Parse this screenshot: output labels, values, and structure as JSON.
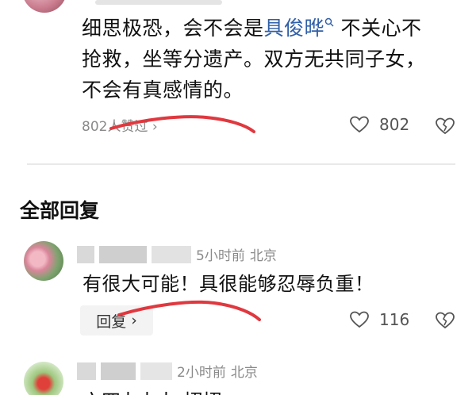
{
  "top_comment": {
    "lines": [
      "细思极恐，会不会是",
      "抢救，坐等分遗产。双方无共同子女，",
      "不会有真感情的。"
    ],
    "link_text": "具俊晔",
    "line1_tail": "不关心不",
    "likes_summary": "802人赞过",
    "like_count": "802"
  },
  "section": {
    "title": "全部回复"
  },
  "reply1": {
    "time": "5小时前",
    "location": "北京",
    "text": "有很大可能！具很能够忍辱负重！",
    "reply_label": "回复",
    "like_count": "116"
  },
  "reply2": {
    "time": "2小时前",
    "location": "北京",
    "text_partial": "六四九九九 招招"
  },
  "colors": {
    "link": "#2f5fa8",
    "annotation": "#e0383f",
    "muted": "#8a8a8a"
  },
  "icons": [
    "heart-icon",
    "broken-heart-icon",
    "search-icon",
    "chevron-right-icon"
  ]
}
